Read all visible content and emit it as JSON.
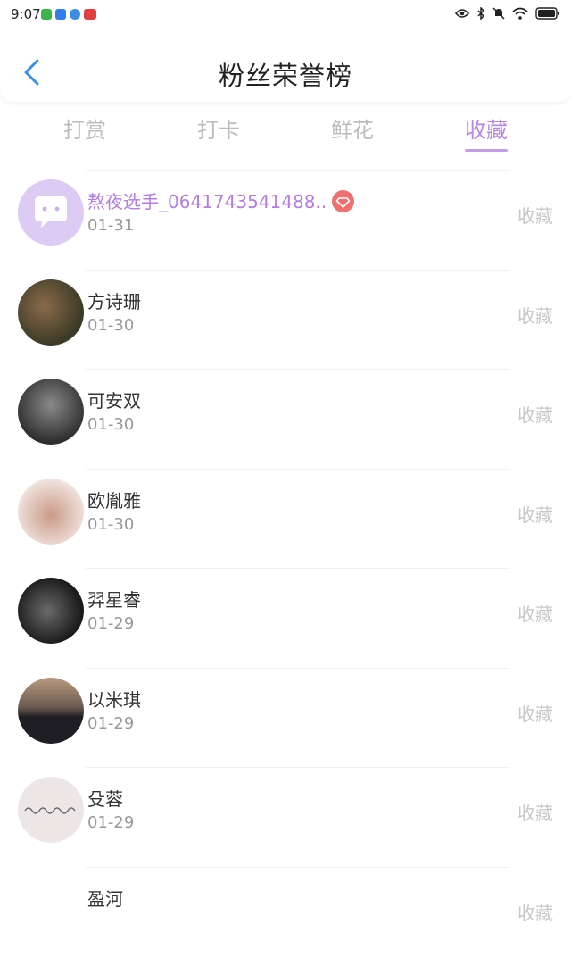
{
  "status": {
    "time": "9:07",
    "notification_icons": [
      "wechat-icon",
      "app-icon",
      "browser-icon",
      "news-icon"
    ],
    "system_icons": [
      "eye-icon",
      "bluetooth-icon",
      "mute-icon",
      "wifi-icon",
      "battery-icon"
    ]
  },
  "header": {
    "title": "粉丝荣誉榜"
  },
  "tabs": [
    {
      "label": "打赏",
      "active": false
    },
    {
      "label": "打卡",
      "active": false
    },
    {
      "label": "鲜花",
      "active": false
    },
    {
      "label": "收藏",
      "active": true
    }
  ],
  "colors": {
    "accent": "#b687e0",
    "inactive": "#bdbdbd",
    "vip": "#f07070"
  },
  "fans": [
    {
      "name": "熬夜选手_0641743541488..",
      "date": "01-31",
      "action": "收藏"
    },
    {
      "name": "方诗珊",
      "date": "01-30",
      "action": "收藏"
    },
    {
      "name": "可安双",
      "date": "01-30",
      "action": "收藏"
    },
    {
      "name": "欧胤雅",
      "date": "01-30",
      "action": "收藏"
    },
    {
      "name": "羿星睿",
      "date": "01-29",
      "action": "收藏"
    },
    {
      "name": "以米琪",
      "date": "01-29",
      "action": "收藏"
    },
    {
      "name": "殳蓉",
      "date": "01-29",
      "action": "收藏"
    },
    {
      "name": "盈河",
      "date": "",
      "action": "收藏"
    }
  ],
  "first_fan_badge": "vip-diamond-icon",
  "first_avatar_icon": "chat-bubble-icon"
}
